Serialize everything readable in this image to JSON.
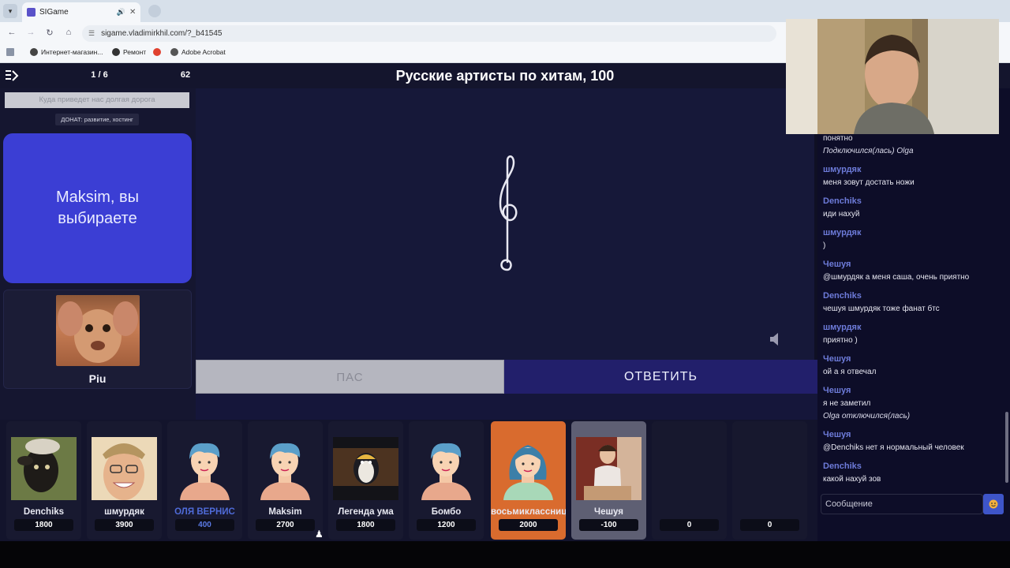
{
  "browser": {
    "tab_title": "SIGame",
    "url": "sigame.vladimirkhil.com/?_b41545",
    "bookmarks": [
      "Интернет-магазин...",
      "Ремонт",
      "Adobe Acrobat"
    ],
    "colors": {
      "chrome": "#d7e0ea",
      "toolbar": "#f5f7fa"
    }
  },
  "header": {
    "round": "1 / 6",
    "timer": "62",
    "question_title": "Русские артисты по хитам, 100"
  },
  "left": {
    "hint_placeholder": "Куда приведет нас долгая дорога",
    "donate": "ДОНАТ: развитие, хостинг",
    "status": "Maksim, вы выбираете",
    "showman_name": "Piu"
  },
  "stage": {
    "pass_label": "ПАС",
    "answer_label": "ОТВЕТИТЬ",
    "media_icon": "treble-clef-icon"
  },
  "players": [
    {
      "name": "Denchiks",
      "score": "1800",
      "state": "normal",
      "avatar": "sheep-photo"
    },
    {
      "name": "шмурдяк",
      "score": "3900",
      "state": "normal",
      "avatar": "smiling-man-photo"
    },
    {
      "name": "ОЛЯ ВЕРНИС",
      "score": "400",
      "state": "highlight",
      "avatar": "default-avatar"
    },
    {
      "name": "Maksim",
      "score": "2700",
      "state": "normal",
      "avatar": "default-avatar"
    },
    {
      "name": "Легенда ума",
      "score": "1800",
      "state": "normal",
      "avatar": "penguin-photo"
    },
    {
      "name": "Бомбо",
      "score": "1200",
      "state": "normal",
      "avatar": "default-avatar"
    },
    {
      "name": "восьмиклассница",
      "score": "2000",
      "state": "active",
      "avatar": "female-avatar"
    },
    {
      "name": "Чешуя",
      "score": "-100",
      "state": "selected",
      "avatar": "man-photo"
    },
    {
      "name": "",
      "score": "0",
      "state": "empty",
      "avatar": ""
    },
    {
      "name": "",
      "score": "0",
      "state": "empty",
      "avatar": ""
    }
  ],
  "chat": {
    "messages": [
      {
        "author": "",
        "text": "понятно"
      },
      {
        "author": "",
        "text": "Подключился(лась) Olga",
        "system": true
      },
      {
        "author": "шмурдяк",
        "text": "меня зовут достать ножи"
      },
      {
        "author": "Denchiks",
        "text": "иди нахуй"
      },
      {
        "author": "шмурдяк",
        "text": ")"
      },
      {
        "author": "Чешуя",
        "text": "@шмурдяк а меня саша, очень приятно"
      },
      {
        "author": "Denchiks",
        "text": "чешуя шмурдяк тоже фанат бтс"
      },
      {
        "author": "шмурдяк",
        "text": "приятно )"
      },
      {
        "author": "Чешуя",
        "text": "ой а я отвечал"
      },
      {
        "author": "Чешуя",
        "text": "я не заметил"
      },
      {
        "author": "",
        "text": "Olga отключился(лась)",
        "system": true
      },
      {
        "author": "Чешуя",
        "text": "@Denchiks нет я нормальный человек"
      },
      {
        "author": "Denchiks",
        "text": "какой нахуй зов"
      }
    ],
    "input_placeholder": "Сообщение"
  },
  "colors": {
    "accent_blue": "#3b3ed4",
    "active_player": "#d96b2e",
    "author": "#6d7bd9"
  }
}
